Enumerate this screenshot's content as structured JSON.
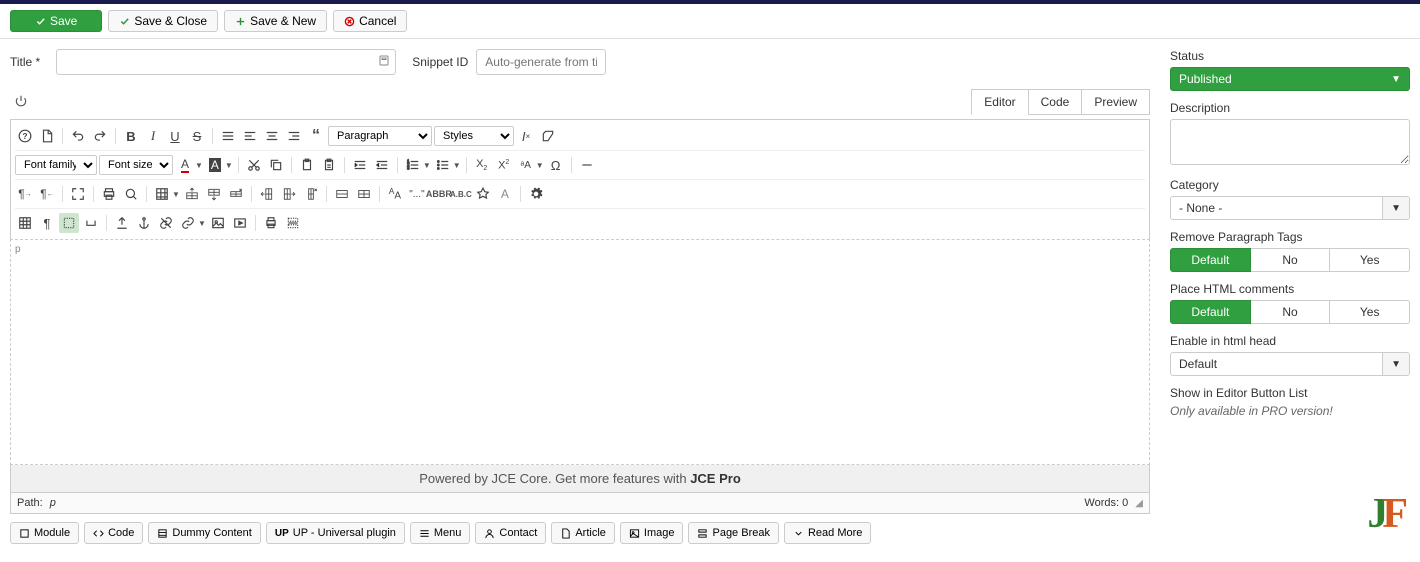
{
  "actions": {
    "save": "Save",
    "save_close": "Save & Close",
    "save_new": "Save & New",
    "cancel": "Cancel"
  },
  "title_row": {
    "title_label": "Title *",
    "snippet_label": "Snippet ID",
    "snippet_placeholder": "Auto-generate from title"
  },
  "tabs": {
    "editor": "Editor",
    "code": "Code",
    "preview": "Preview"
  },
  "toolbar": {
    "paragraph": "Paragraph",
    "styles": "Styles",
    "fontfamily": "Font family",
    "fontsize": "Font size"
  },
  "footer": {
    "powered_pre": "Powered by JCE Core. Get more features with ",
    "powered_strong": "JCE Pro"
  },
  "path_bar": {
    "path_label": "Path:",
    "path_val": "p",
    "words_label": "Words: 0"
  },
  "bottom_buttons": {
    "module": "Module",
    "code": "Code",
    "dummy": "Dummy Content",
    "up": "UP - Universal plugin",
    "menu": "Menu",
    "contact": "Contact",
    "article": "Article",
    "image": "Image",
    "pagebreak": "Page Break",
    "readmore": "Read More"
  },
  "sidebar": {
    "status_label": "Status",
    "status_value": "Published",
    "description_label": "Description",
    "category_label": "Category",
    "category_value": "- None -",
    "remove_para_label": "Remove Paragraph Tags",
    "place_html_label": "Place HTML comments",
    "enable_head_label": "Enable in html head",
    "enable_head_value": "Default",
    "show_editor_label": "Show in Editor Button List",
    "pro_note": "Only available in PRO version!",
    "seg_default": "Default",
    "seg_no": "No",
    "seg_yes": "Yes"
  },
  "editor_tag": "p"
}
